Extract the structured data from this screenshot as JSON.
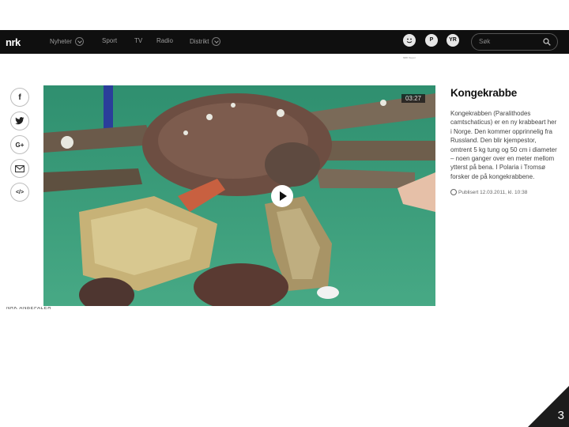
{
  "header": {
    "logo": "nrk",
    "nav": [
      {
        "label": "Nyheter",
        "dropdown": true
      },
      {
        "label": "Sport",
        "dropdown": false
      },
      {
        "label": "TV",
        "dropdown": false
      },
      {
        "label": "Radio",
        "dropdown": false
      },
      {
        "label": "Distrikt",
        "dropdown": true
      }
    ],
    "icons": [
      {
        "name": "nrk-super-icon",
        "text": "",
        "sub": "NRK Super"
      },
      {
        "name": "p3-icon",
        "text": "P"
      },
      {
        "name": "yr-icon",
        "text": "YR"
      }
    ],
    "search_placeholder": "Søk"
  },
  "share": [
    {
      "name": "facebook-icon",
      "glyph": "f"
    },
    {
      "name": "twitter-icon",
      "glyph": "t"
    },
    {
      "name": "google-plus-icon",
      "glyph": "G+"
    },
    {
      "name": "email-icon",
      "glyph": "✉"
    },
    {
      "name": "embed-icon",
      "glyph": "</>"
    }
  ],
  "video": {
    "duration": "03:27"
  },
  "article": {
    "title": "Kongekrabbe",
    "body": "Kongekrabben (Paralithodes camtschaticus) er en ny krabbeart her i Norge. Den kommer opprinnelig fra Russland. Den blir kjempestor, omtrent 5 kg tung og 50 cm i diameter – noen ganger over en meter mellom ytterst på bena. I Polaria i Tromsø forsker de på kongekrabbene.",
    "published": "Publisert 12.03.2011, kl. 10:38"
  },
  "below_label": "NRK ANBEFALER",
  "slide_number": "3",
  "colors": {
    "topbar": "#0f0f0f",
    "water": "#3a9a7a"
  }
}
